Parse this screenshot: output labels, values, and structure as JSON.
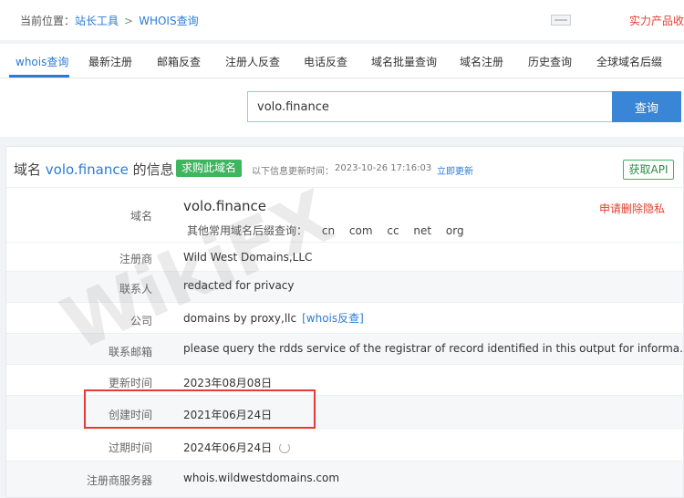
{
  "breadcrumb": {
    "location_label": "当前位置：",
    "tools_link": "站长工具",
    "separator": ">",
    "current": "WHOIS查询"
  },
  "promo_text": "实力产品收",
  "tabs": [
    {
      "label": "whois查询",
      "active": true
    },
    {
      "label": "最新注册"
    },
    {
      "label": "邮箱反查"
    },
    {
      "label": "注册人反查"
    },
    {
      "label": "电话反查"
    },
    {
      "label": "域名批量查询"
    },
    {
      "label": "域名注册"
    },
    {
      "label": "历史查询"
    },
    {
      "label": "全球域名后缀"
    }
  ],
  "search": {
    "value": "volo.finance",
    "button_label": "查询"
  },
  "panel": {
    "title_prefix": "域名",
    "title_domain": "volo.finance",
    "title_suffix": "的信息",
    "buy_label": "求购此域名",
    "update_label": "以下信息更新时间：",
    "update_time": "2023-10-26 17:16:03",
    "update_link": "立即更新",
    "api_label": "获取API"
  },
  "rows": {
    "domain": {
      "label": "域名",
      "value": "volo.finance",
      "action": "申请删除隐私",
      "suffix_label": "其他常用域名后缀查询：",
      "suffixes": [
        "cn",
        "com",
        "cc",
        "net",
        "org"
      ]
    },
    "registrar": {
      "label": "注册商",
      "value": "Wild West Domains,LLC"
    },
    "contact": {
      "label": "联系人",
      "value": "redacted for privacy"
    },
    "company": {
      "label": "公司",
      "value": "domains by proxy,llc",
      "link": "[whois反查]"
    },
    "email": {
      "label": "联系邮箱",
      "value": "please query the rdds service of the registrar of record identified in this output for informa..."
    },
    "updated": {
      "label": "更新时间",
      "value": "2023年08月08日"
    },
    "created": {
      "label": "创建时间",
      "value": "2021年06月24日"
    },
    "expires": {
      "label": "过期时间",
      "value": "2024年06月24日"
    },
    "server": {
      "label": "注册商服务器",
      "value": "whois.wildwestdomains.com"
    }
  },
  "watermark": "WikiFX",
  "colors": {
    "accent": "#2b7bd6",
    "buy_green": "#3eb55f",
    "highlight_red": "#e53b32"
  }
}
